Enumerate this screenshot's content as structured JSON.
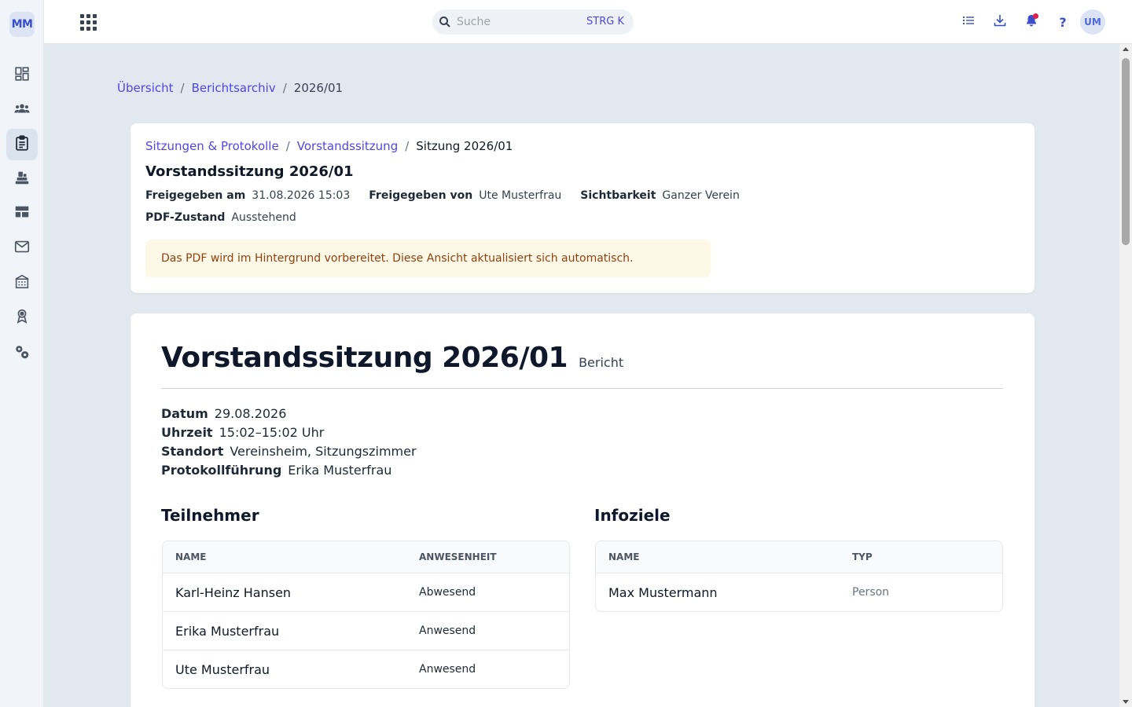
{
  "sidebar": {
    "logo": "MM",
    "items": [
      {
        "icon": "dashboard-icon"
      },
      {
        "icon": "members-icon"
      },
      {
        "icon": "clipboard-icon"
      },
      {
        "icon": "inventory-icon"
      },
      {
        "icon": "table-icon"
      },
      {
        "icon": "mail-icon"
      },
      {
        "icon": "building-icon"
      },
      {
        "icon": "award-icon"
      },
      {
        "icon": "settings-icon"
      }
    ]
  },
  "topbar": {
    "search_placeholder": "Suche",
    "search_shortcut": "STRG K",
    "help_label": "?",
    "avatar": "UM"
  },
  "breadcrumb": {
    "items": [
      "Übersicht",
      "Berichtsarchiv"
    ],
    "current": "2026/01"
  },
  "meta_card": {
    "breadcrumb": {
      "items": [
        "Sitzungen & Protokolle",
        "Vorstandssitzung"
      ],
      "current": "Sitzung 2026/01"
    },
    "title": "Vorstandssitzung 2026/01",
    "released_at_label": "Freigegeben am",
    "released_at": "31.08.2026 15:03",
    "released_by_label": "Freigegeben von",
    "released_by": "Ute Musterfrau",
    "visibility_label": "Sichtbarkeit",
    "visibility": "Ganzer Verein",
    "pdf_label": "PDF-Zustand",
    "pdf_state": "Ausstehend",
    "alert": "Das PDF wird im Hintergrund vorbereitet. Diese Ansicht aktualisiert sich automatisch."
  },
  "report": {
    "title": "Vorstandssitzung 2026/01",
    "badge": "Bericht",
    "facts": {
      "date_label": "Datum",
      "date": "29.08.2026",
      "time_label": "Uhrzeit",
      "time": "15:02–15:02 Uhr",
      "location_label": "Standort",
      "location": "Vereinsheim, Sitzungszimmer",
      "minutes_label": "Protokollführung",
      "minutes": "Erika Musterfrau"
    },
    "participants": {
      "title": "Teilnehmer",
      "headers": [
        "NAME",
        "ANWESENHEIT"
      ],
      "rows": [
        {
          "name": "Karl-Heinz Hansen",
          "attendance": "Abwesend"
        },
        {
          "name": "Erika Musterfrau",
          "attendance": "Anwesend"
        },
        {
          "name": "Ute Musterfrau",
          "attendance": "Anwesend"
        }
      ]
    },
    "info_targets": {
      "title": "Infoziele",
      "headers": [
        "NAME",
        "TYP"
      ],
      "rows": [
        {
          "name": "Max Mustermann",
          "type": "Person"
        }
      ]
    }
  },
  "colors": {
    "accent": "#4f46e5",
    "background": "#e2e8f0",
    "alert_bg": "#fef9e7",
    "alert_text": "#92400e",
    "notification_dot": "#e11d48"
  }
}
